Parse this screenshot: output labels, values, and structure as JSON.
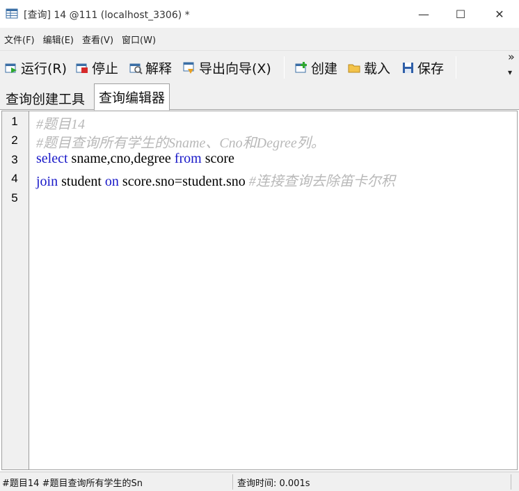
{
  "window": {
    "title": "[查询] 14 @111 (localhost_3306) *",
    "minimize_glyph": "—",
    "maximize_glyph": "☐",
    "close_glyph": "✕"
  },
  "menu": [
    "文件(F)",
    "编辑(E)",
    "查看(V)",
    "窗口(W)"
  ],
  "toolbar": {
    "run_label": "运行(R)",
    "stop_label": "停止",
    "explain_label": "解释",
    "export_label": "导出向导(X)",
    "create_label": "创建",
    "load_label": "载入",
    "save_label": "保存",
    "more_glyph": "»",
    "more_down_glyph": "▾"
  },
  "tabs": [
    "查询创建工具",
    "查询编辑器"
  ],
  "active_tab": "查询编辑器",
  "editor": {
    "line_numbers": [
      "1",
      "2",
      "3",
      "4",
      "5"
    ],
    "lines": [
      {
        "comment": "#题目14"
      },
      {
        "comment": "#题目查询所有学生的Sname、Cno和Degree列。"
      },
      {
        "kw1": "select",
        "t1": " sname,cno,degree ",
        "kw2": "from",
        "t2": " score"
      },
      {
        "kw1": "join",
        "t1": " student ",
        "kw2": "on",
        "t2": " score.sno=student.sno ",
        "comment": "#连接查询去除笛卡尔积"
      },
      {}
    ]
  },
  "status": {
    "left": "#题目14 #题目查询所有学生的Sn",
    "right": "查询时间: 0.001s"
  },
  "colors": {
    "keyword": "#1818c8",
    "comment": "#b8b8b8",
    "chrome": "#f0f0f0"
  }
}
